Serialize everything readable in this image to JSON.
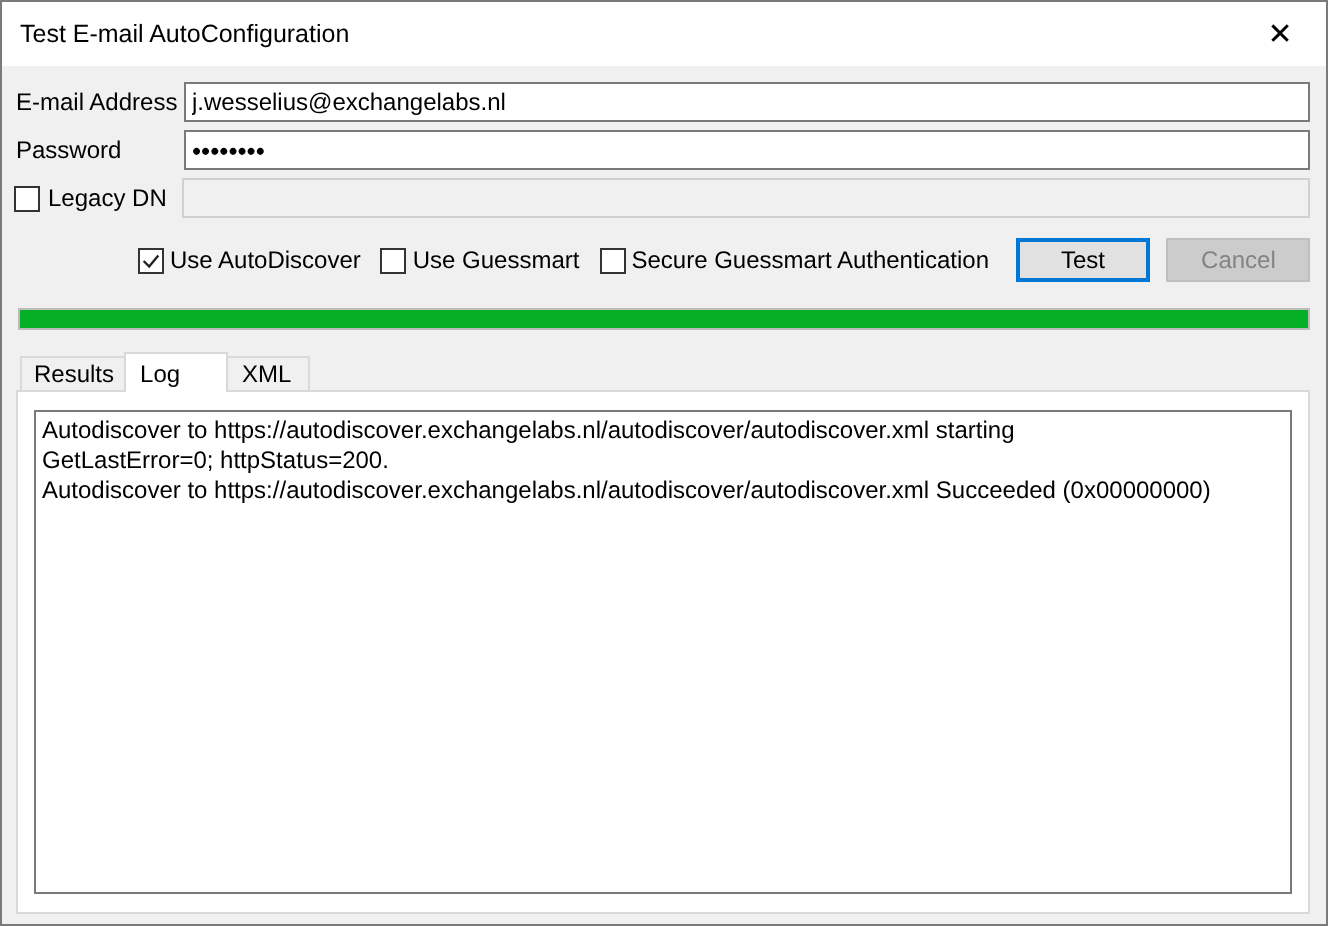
{
  "window": {
    "title": "Test E-mail AutoConfiguration",
    "close_glyph": "✕"
  },
  "fields": [
    {
      "label": "E-mail Address",
      "value": "j.wesselius@exchangelabs.nl",
      "kind": "text"
    },
    {
      "label": "Password",
      "value": "••••••••",
      "kind": "password"
    }
  ],
  "legacy_dn": {
    "label": "Legacy DN",
    "checked": false,
    "disabled": true
  },
  "options": [
    {
      "label": "Use AutoDiscover",
      "checked": true
    },
    {
      "label": "Use Guessmart",
      "checked": false
    },
    {
      "label": "Secure Guessmart Authentication",
      "checked": false
    }
  ],
  "buttons": [
    {
      "label": "Test",
      "disabled": false,
      "default": true
    },
    {
      "label": "Cancel",
      "disabled": true,
      "default": false
    }
  ],
  "progress": {
    "level": 1
  },
  "tabs": [
    {
      "label": "Results",
      "selected": false
    },
    {
      "label": "Log",
      "selected": true
    },
    {
      "label": "XML",
      "selected": false
    }
  ],
  "log": [
    "Autodiscover to https://autodiscover.exchangelabs.nl/autodiscover/autodiscover.xml starting",
    "GetLastError=0; httpStatus=200.",
    "Autodiscover to https://autodiscover.exchangelabs.nl/autodiscover/autodiscover.xml Succeeded (0x00000000)"
  ]
}
